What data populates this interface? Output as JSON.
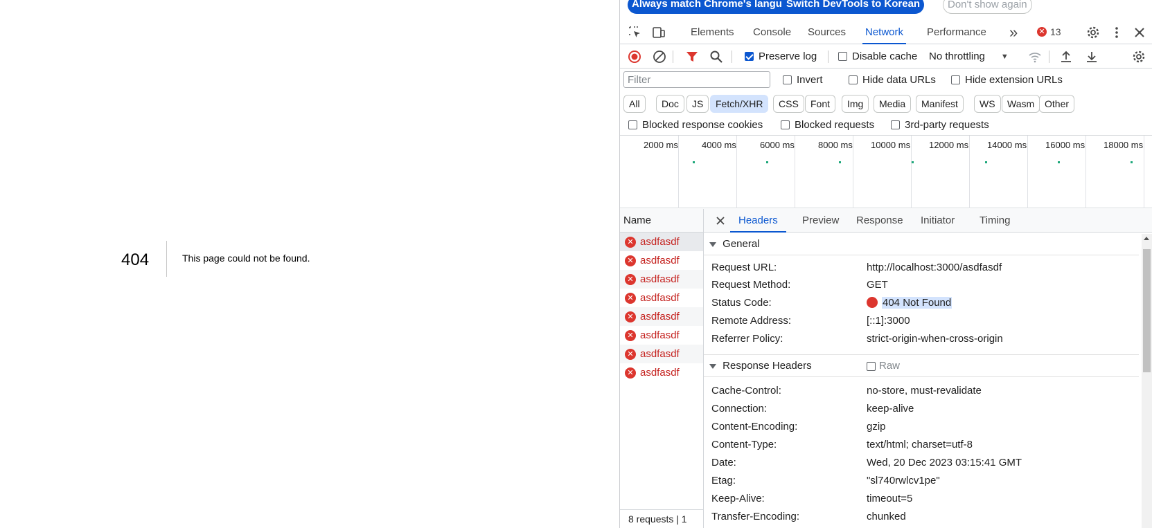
{
  "page": {
    "code": "404",
    "message": "This page could not be found."
  },
  "infobar": {
    "match_language": "Always match Chrome's language",
    "switch_language": "Switch DevTools to Korean",
    "dont_show": "Don't show again"
  },
  "toolbar": {
    "tabs": [
      "Elements",
      "Console",
      "Sources",
      "Network",
      "Performance"
    ],
    "active_tab": "Network",
    "more": "»",
    "error_count": "13"
  },
  "network_toolbar": {
    "preserve_log": "Preserve log",
    "preserve_log_checked": true,
    "disable_cache": "Disable cache",
    "disable_cache_checked": false,
    "throttling": "No throttling"
  },
  "filter": {
    "placeholder": "Filter",
    "invert": "Invert",
    "hide_data_urls": "Hide data URLs",
    "hide_extension_urls": "Hide extension URLs"
  },
  "types": [
    "All",
    "Doc",
    "JS",
    "Fetch/XHR",
    "CSS",
    "Font",
    "Img",
    "Media",
    "Manifest",
    "WS",
    "Wasm",
    "Other"
  ],
  "active_type": "Fetch/XHR",
  "blocked": {
    "response_cookies": "Blocked response cookies",
    "requests": "Blocked requests",
    "third_party": "3rd-party requests"
  },
  "overview": {
    "ticks": [
      "2000 ms",
      "4000 ms",
      "6000 ms",
      "8000 ms",
      "10000 ms",
      "12000 ms",
      "14000 ms",
      "16000 ms",
      "18000 ms"
    ]
  },
  "requests": {
    "header": "Name",
    "items": [
      "asdfasdf",
      "asdfasdf",
      "asdfasdf",
      "asdfasdf",
      "asdfasdf",
      "asdfasdf",
      "asdfasdf",
      "asdfasdf"
    ],
    "summary": "8 requests | 1"
  },
  "detail": {
    "tabs": [
      "Headers",
      "Preview",
      "Response",
      "Initiator",
      "Timing"
    ],
    "active_tab": "Headers",
    "general": {
      "title": "General",
      "rows": [
        {
          "key": "Request URL:",
          "value": "http://localhost:3000/asdfasdf"
        },
        {
          "key": "Request Method:",
          "value": "GET"
        },
        {
          "key": "Status Code:",
          "value": "404 Not Found"
        },
        {
          "key": "Remote Address:",
          "value": "[::1]:3000"
        },
        {
          "key": "Referrer Policy:",
          "value": "strict-origin-when-cross-origin"
        }
      ]
    },
    "response_headers": {
      "title": "Response Headers",
      "raw": "Raw",
      "rows": [
        {
          "key": "Cache-Control:",
          "value": "no-store, must-revalidate"
        },
        {
          "key": "Connection:",
          "value": "keep-alive"
        },
        {
          "key": "Content-Encoding:",
          "value": "gzip"
        },
        {
          "key": "Content-Type:",
          "value": "text/html; charset=utf-8"
        },
        {
          "key": "Date:",
          "value": "Wed, 20 Dec 2023 03:15:41 GMT"
        },
        {
          "key": "Etag:",
          "value": "\"sl740rwlcv1pe\""
        },
        {
          "key": "Keep-Alive:",
          "value": "timeout=5"
        },
        {
          "key": "Transfer-Encoding:",
          "value": "chunked"
        }
      ]
    }
  },
  "colors": {
    "accent": "#0b57d0",
    "error": "#dc362e",
    "error_text": "#c5221f"
  }
}
